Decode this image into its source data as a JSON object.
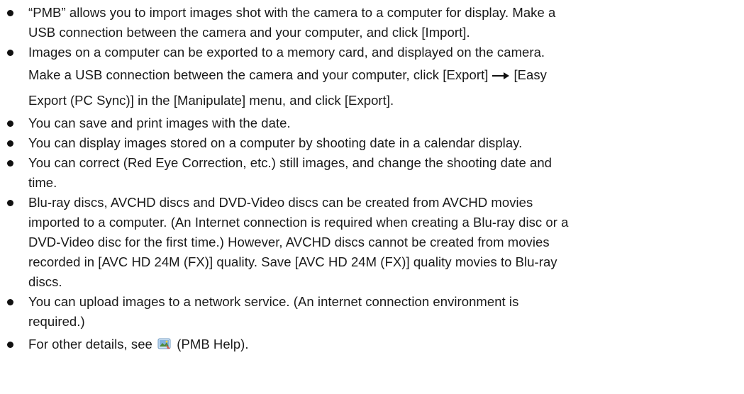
{
  "items": [
    {
      "lines": [
        "“PMB” allows you to import images shot with the camera to a computer for display. Make a",
        "USB connection between the camera and your computer, and click [Import]."
      ]
    },
    {
      "lines": [
        "Images on a computer can be exported to a memory card, and displayed on the camera.",
        "Make a USB connection between the camera and your computer, click [Export]",
        "[Easy",
        "Export (PC Sync)] in the [Manipulate] menu, and click [Export]."
      ]
    },
    {
      "lines": [
        "You can save and print images with the date."
      ]
    },
    {
      "lines": [
        "You can display images stored on a computer by shooting date in a calendar display."
      ]
    },
    {
      "lines": [
        "You can correct (Red Eye Correction, etc.) still images, and change the shooting date and",
        "time."
      ]
    },
    {
      "lines": [
        "Blu-ray discs, AVCHD discs and DVD-Video discs can be created from AVCHD movies",
        "imported to a computer. (An Internet connection is required when creating a Blu-ray disc or a",
        "DVD-Video disc for the first time.) However, AVCHD discs cannot be created from movies",
        "recorded in [AVC HD 24M (FX)] quality. Save [AVC HD 24M (FX)] quality movies to Blu-ray",
        "discs."
      ]
    },
    {
      "lines": [
        "You can upload images to a network service. (An internet connection environment is",
        "required.)"
      ]
    },
    {
      "lines": [
        "For other details, see",
        "(PMB Help)."
      ]
    }
  ],
  "icons": {
    "arrow": "right-arrow-icon",
    "help": "pmb-help-icon"
  }
}
